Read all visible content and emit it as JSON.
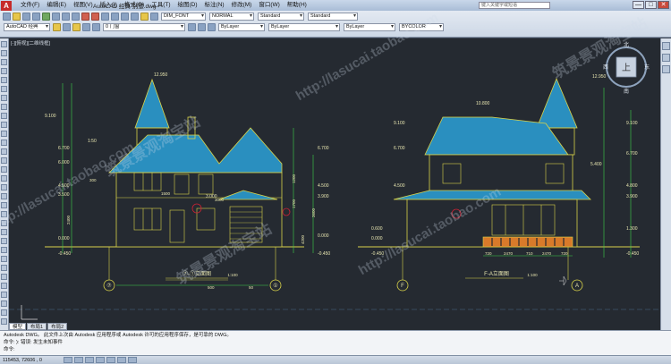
{
  "titlebar": {
    "workspace": "AutoCAD 经典",
    "file": "别墅.dwg",
    "search_placeholder": "键入关键字或短语",
    "menus": [
      "文件(F)",
      "编辑(E)",
      "视图(V)",
      "插入(I)",
      "格式(O)",
      "工具(T)",
      "绘图(D)",
      "标注(N)",
      "修改(M)",
      "窗口(W)",
      "帮助(H)"
    ],
    "minimize": "—",
    "maximize": "□",
    "close": "✕"
  },
  "toolbar": {
    "workspace_combo": "AutoCAD 经典",
    "text_style": "DIM_FONT",
    "dim_style": "NORMAL",
    "table_style": "Standard",
    "ml_style": "Standard",
    "layer_combo": "0 门窗",
    "color_combo": "ByLayer",
    "linetype_combo": "ByLayer",
    "lineweight_combo": "ByLayer",
    "plot_style": "BYCOLOR"
  },
  "canvas": {
    "viewport_label": "[-][俯视][二维线框]",
    "background": "#252a31",
    "line_color": "#d9d34a",
    "roof_color": "#2a8fbf",
    "dim_color": "#3ed04a",
    "text_color": "#e8e6b0"
  },
  "viewcube": {
    "north": "北",
    "south": "南",
    "east": "东",
    "west": "西",
    "top": "上"
  },
  "left_elevation": {
    "levels": [
      "12.950",
      "9.100",
      "6.700",
      "6.000",
      "4.500",
      "3.500",
      "3.000",
      "0.000",
      "-0.450"
    ],
    "right_levels": [
      "6.700",
      "4.500",
      "3.900",
      "0.000",
      "-0.450"
    ],
    "dims": [
      "1200",
      "1700",
      "3000",
      "3600",
      "2400",
      "300",
      "500",
      "50",
      "1500",
      "4200"
    ],
    "grid_left": "⑦",
    "grid_right": "①",
    "label": "⑦-①立面图",
    "scale": "1:100",
    "roof_tag": "1:50"
  },
  "right_elevation": {
    "levels": [
      "10.800",
      "9.100",
      "6.700",
      "4.500",
      "0.600",
      "0.000",
      "-0.450"
    ],
    "right_levels": [
      "12.950",
      "9.100",
      "6.700",
      "5.400",
      "4.800",
      "3.900",
      "1.300",
      "-0.450"
    ],
    "dims": [
      "720",
      "2470",
      "710",
      "2470",
      "720"
    ],
    "grid_left": "F",
    "grid_right": "A",
    "label": "F-A立面图",
    "scale": "1:100"
  },
  "layout_tabs": [
    "模型",
    "布局1",
    "布局2"
  ],
  "command": {
    "line1": "Autodesk DWG。  此文件上次由 Autodesk 应用程序或 Autodesk 许可的应用程序保存，是可靠的 DWG。",
    "line2": "命令: ): 错误: 发生未知事件",
    "prompt": "命令:"
  },
  "status": {
    "coordinates": "115453, 72606 , 0"
  },
  "watermarks": [
    "http://lasucai.taobao.com",
    "筑景景观淘宝站"
  ]
}
